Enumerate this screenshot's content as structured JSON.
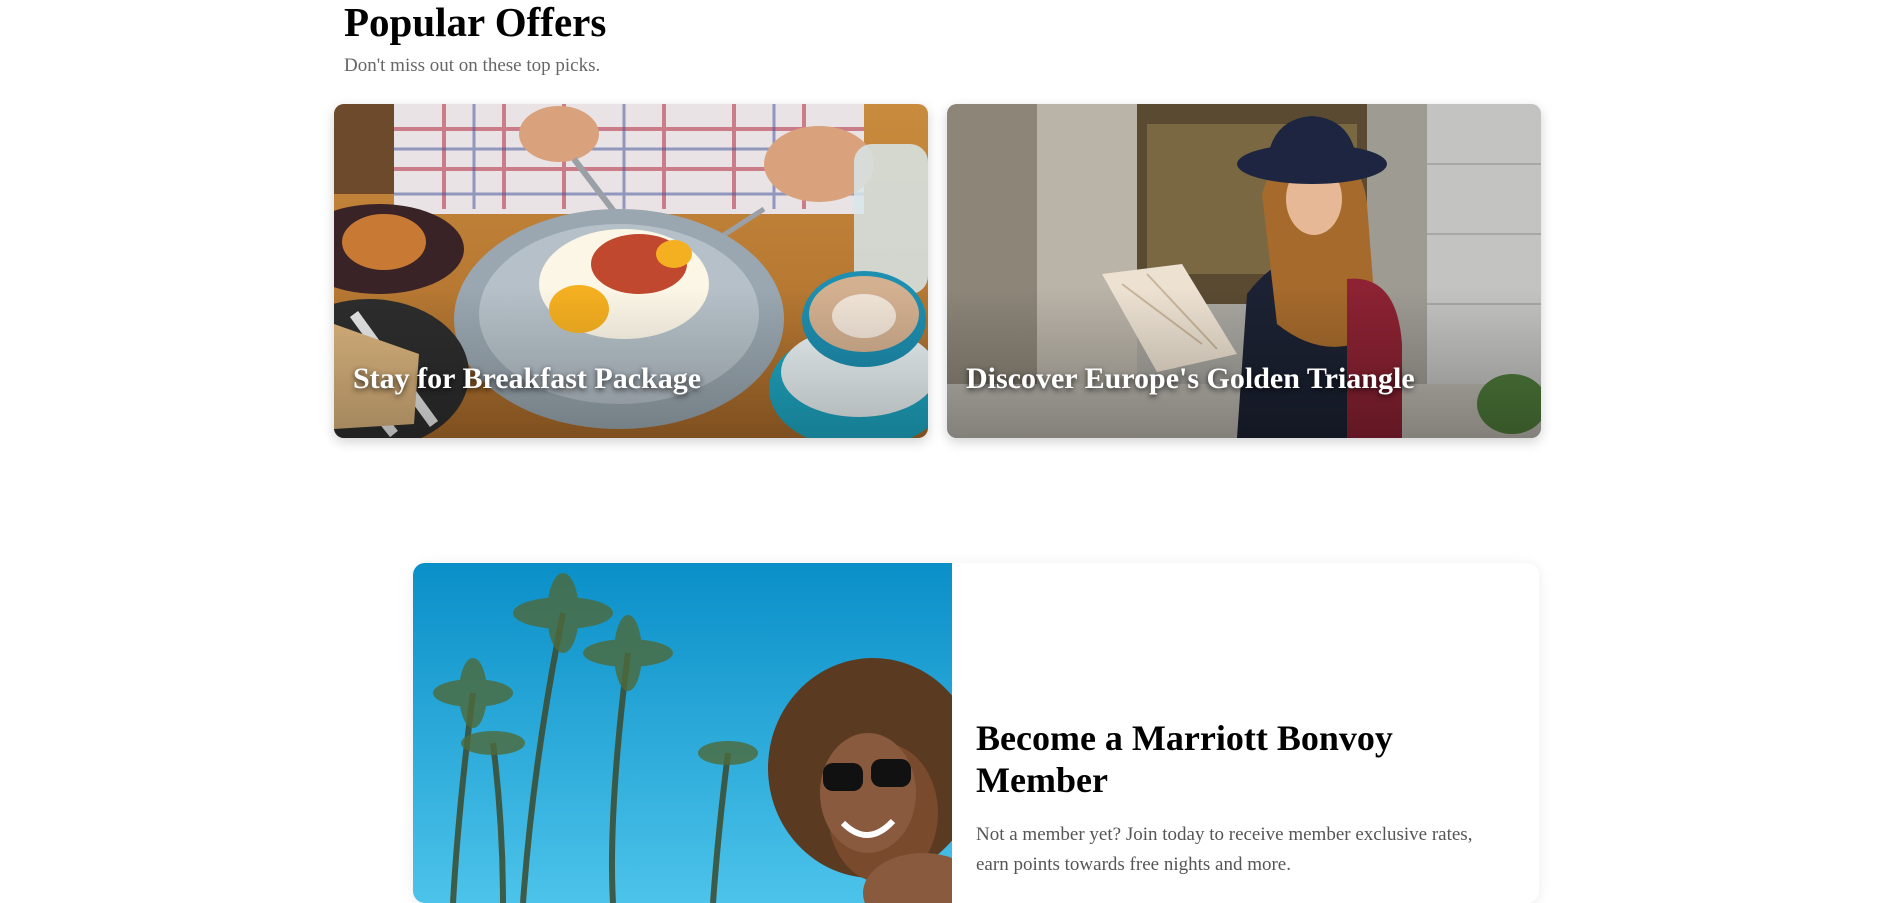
{
  "popular_offers": {
    "title": "Popular Offers",
    "subtitle": "Don't miss out on these top picks.",
    "cards": [
      {
        "title": "Stay for Breakfast Package",
        "image": "breakfast-table-photo"
      },
      {
        "title": "Discover Europe's Golden Triangle",
        "image": "woman-with-map-photo"
      }
    ]
  },
  "membership": {
    "title": "Become a Marriott Bonvoy Member",
    "description": "Not a member yet? Join today to receive member exclusive rates, earn points towards free nights and more.",
    "image": "woman-palm-trees-photo"
  },
  "colors": {
    "heading": "#000000",
    "subtitle": "#666666",
    "body_text": "#555555",
    "card_title": "#ffffff",
    "sky": "#0aa0d6"
  }
}
